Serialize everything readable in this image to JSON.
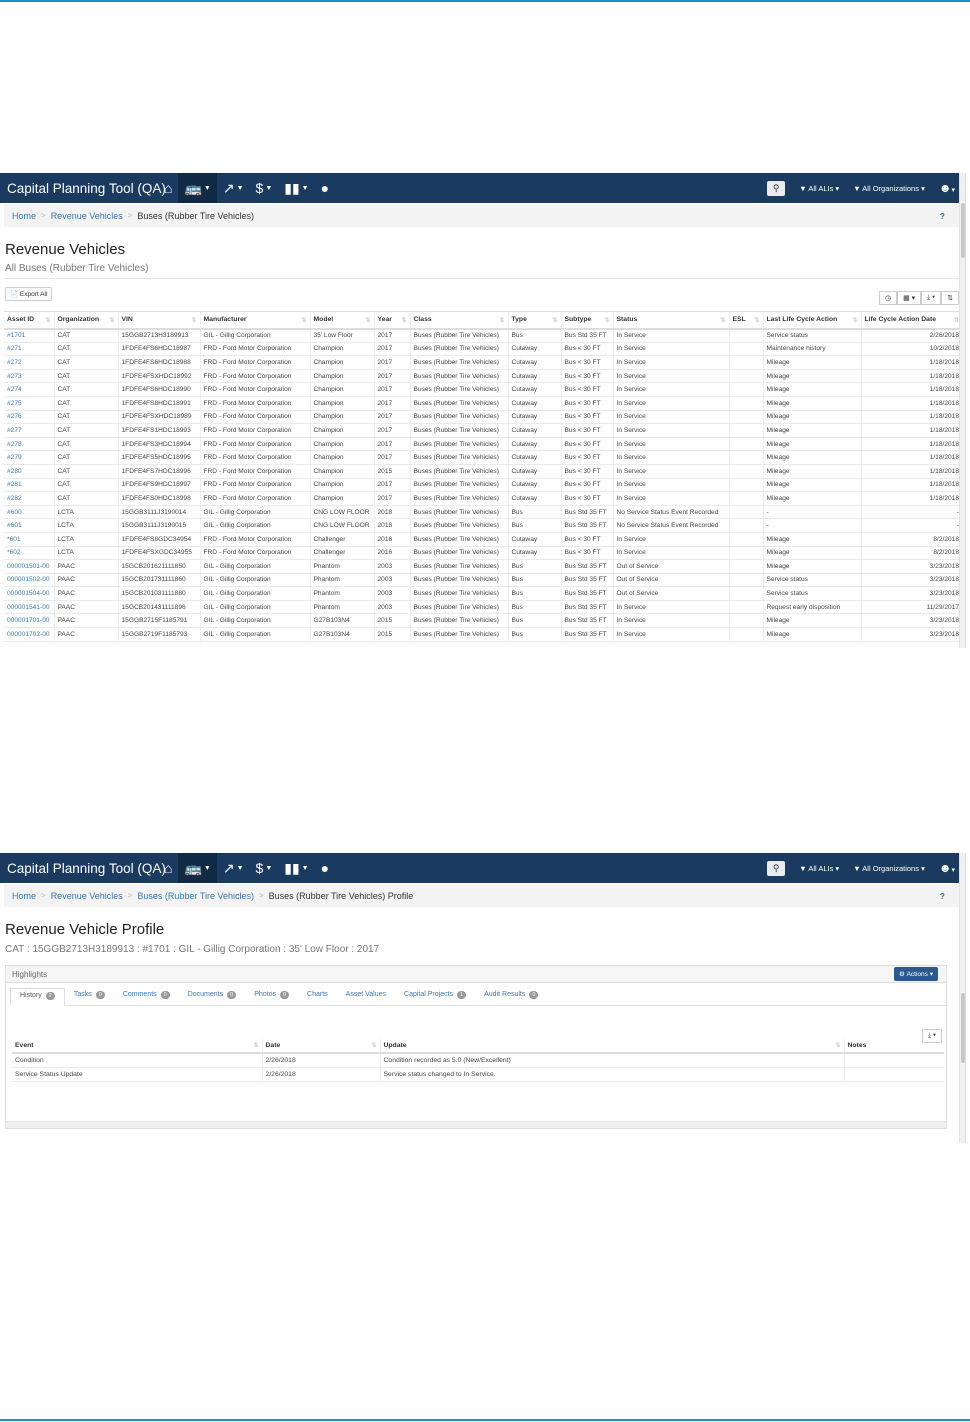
{
  "screen1": {
    "navbar": {
      "brand": "Capital Planning Tool (QA)",
      "icons": [
        "home-icon",
        "bus-icon",
        "chart-line-icon",
        "dollar-icon",
        "bar-chart-icon",
        "globe-icon"
      ],
      "filter_alis": "All ALIs",
      "filter_orgs": "All Organizations"
    },
    "breadcrumb": [
      "Home",
      "Revenue Vehicles",
      "Buses (Rubber Tire Vehicles)"
    ],
    "help": "?",
    "title": "Revenue Vehicles",
    "subtitle": "All Buses (Rubber Tire Vehicles)",
    "export_label": "Export All",
    "columns": [
      "Asset ID",
      "Organization",
      "VIN",
      "Manufacturer",
      "Model",
      "Year",
      "Class",
      "Type",
      "Subtype",
      "Status",
      "ESL",
      "Last Life Cycle Action",
      "Life Cycle Action Date"
    ],
    "rows": [
      [
        "#1701",
        "CAT",
        "15GGB2713H3189913",
        "GIL - Gillig Corporation",
        "35' Low Floor",
        "2017",
        "Buses (Rubber Tire Vehicles)",
        "Bus",
        "Bus Std 35 FT",
        "In Service",
        "",
        "Service status",
        "2/26/2018"
      ],
      [
        "#271",
        "CAT",
        "1FDFE4FS6HDC18987",
        "FRD - Ford Motor Corporation",
        "Champion",
        "2017",
        "Buses (Rubber Tire Vehicles)",
        "Cutaway",
        "Bus < 30 FT",
        "In Service",
        "",
        "Maintenance history",
        "10/2/2018"
      ],
      [
        "#272",
        "CAT",
        "1FDFE4FS6HDC18988",
        "FRD - Ford Motor Corporation",
        "Champion",
        "2017",
        "Buses (Rubber Tire Vehicles)",
        "Cutaway",
        "Bus < 30 FT",
        "In Service",
        "",
        "Mileage",
        "1/18/2018"
      ],
      [
        "#273",
        "CAT",
        "1FDFE4FSXHDC18992",
        "FRD - Ford Motor Corporation",
        "Champion",
        "2017",
        "Buses (Rubber Tire Vehicles)",
        "Cutaway",
        "Bus < 30 FT",
        "In Service",
        "",
        "Mileage",
        "1/18/2018"
      ],
      [
        "#274",
        "CAT",
        "1FDFE4FS6HDC18990",
        "FRD - Ford Motor Corporation",
        "Champion",
        "2017",
        "Buses (Rubber Tire Vehicles)",
        "Cutaway",
        "Bus < 30 FT",
        "In Service",
        "",
        "Mileage",
        "1/18/2018"
      ],
      [
        "#275",
        "CAT",
        "1FDFE4FS8HDC18991",
        "FRD - Ford Motor Corporation",
        "Champion",
        "2017",
        "Buses (Rubber Tire Vehicles)",
        "Cutaway",
        "Bus < 30 FT",
        "In Service",
        "",
        "Mileage",
        "1/18/2018"
      ],
      [
        "#276",
        "CAT",
        "1FDFE4FSXHDC18989",
        "FRD - Ford Motor Corporation",
        "Champion",
        "2017",
        "Buses (Rubber Tire Vehicles)",
        "Cutaway",
        "Bus < 30 FT",
        "In Service",
        "",
        "Mileage",
        "1/18/2018"
      ],
      [
        "#277",
        "CAT",
        "1FDFE4FS1HDC18993",
        "FRD - Ford Motor Corporation",
        "Champion",
        "2017",
        "Buses (Rubber Tire Vehicles)",
        "Cutaway",
        "Bus < 30 FT",
        "In Service",
        "",
        "Mileage",
        "1/18/2018"
      ],
      [
        "#278",
        "CAT",
        "1FDFE4FS3HDC18994",
        "FRD - Ford Motor Corporation",
        "Champion",
        "2017",
        "Buses (Rubber Tire Vehicles)",
        "Cutaway",
        "Bus < 30 FT",
        "In Service",
        "",
        "Mileage",
        "1/18/2018"
      ],
      [
        "#279",
        "CAT",
        "1FDFE4FS5HDC18995",
        "FRD - Ford Motor Corporation",
        "Champion",
        "2017",
        "Buses (Rubber Tire Vehicles)",
        "Cutaway",
        "Bus < 30 FT",
        "In Service",
        "",
        "Mileage",
        "1/18/2018"
      ],
      [
        "#280",
        "CAT",
        "1FDFE4FS7HDC18996",
        "FRD - Ford Motor Corporation",
        "Champion",
        "2015",
        "Buses (Rubber Tire Vehicles)",
        "Cutaway",
        "Bus < 30 FT",
        "In Service",
        "",
        "Mileage",
        "1/18/2018"
      ],
      [
        "#281",
        "CAT",
        "1FDFE4FS9HDC18997",
        "FRD - Ford Motor Corporation",
        "Champion",
        "2017",
        "Buses (Rubber Tire Vehicles)",
        "Cutaway",
        "Bus < 30 FT",
        "In Service",
        "",
        "Mileage",
        "1/18/2018"
      ],
      [
        "#282",
        "CAT",
        "1FDFE4FS0HDC18998",
        "FRD - Ford Motor Corporation",
        "Champion",
        "2017",
        "Buses (Rubber Tire Vehicles)",
        "Cutaway",
        "Bus < 30 FT",
        "In Service",
        "",
        "Mileage",
        "1/18/2018"
      ],
      [
        "#600",
        "LCTA",
        "15GGB3111J3190014",
        "GIL - Gillig Corporation",
        "CNG LOW FLOOR",
        "2018",
        "Buses (Rubber Tire Vehicles)",
        "Bus",
        "Bus Std 35 FT",
        "No Service Status Event Recorded",
        "",
        "-",
        "-"
      ],
      [
        "#601",
        "LCTA",
        "15GGB3111J3190015",
        "GIL - Gillig Corporation",
        "CNG LOW FLOOR",
        "2018",
        "Buses (Rubber Tire Vehicles)",
        "Bus",
        "Bus Std 35 FT",
        "No Service Status Event Recorded",
        "",
        "-",
        "-"
      ],
      [
        "*601",
        "LCTA",
        "1FDFE4FS8GDC34954",
        "FRD - Ford Motor Corporation",
        "Challenger",
        "2016",
        "Buses (Rubber Tire Vehicles)",
        "Cutaway",
        "Bus < 30 FT",
        "In Service",
        "",
        "Mileage",
        "8/2/2018"
      ],
      [
        "*602",
        "LCTA",
        "1FDFE4FSXGDC34955",
        "FRD - Ford Motor Corporation",
        "Challenger",
        "2016",
        "Buses (Rubber Tire Vehicles)",
        "Cutaway",
        "Bus < 30 FT",
        "In Service",
        "",
        "Mileage",
        "8/2/2018"
      ],
      [
        "000001501-00",
        "PAAC",
        "15GCB201621111850",
        "GIL - Gillig Corporation",
        "Phantom",
        "2003",
        "Buses (Rubber Tire Vehicles)",
        "Bus",
        "Bus Std 35 FT",
        "Out of Service",
        "",
        "Mileage",
        "3/23/2018"
      ],
      [
        "000001502-00",
        "PAAC",
        "15GCB201731111860",
        "GIL - Gillig Corporation",
        "Phantom",
        "2003",
        "Buses (Rubber Tire Vehicles)",
        "Bus",
        "Bus Std 35 FT",
        "Out of Service",
        "",
        "Service status",
        "3/23/2018"
      ],
      [
        "000001504-00",
        "PAAC",
        "15GCB201031111880",
        "GIL - Gillig Corporation",
        "Phantom",
        "2003",
        "Buses (Rubber Tire Vehicles)",
        "Bus",
        "Bus Std 35 FT",
        "Out of Service",
        "",
        "Service status",
        "3/23/2018"
      ],
      [
        "000001541-00",
        "PAAC",
        "15GCB201431111896",
        "GIL - Gillig Corporation",
        "Phantom",
        "2003",
        "Buses (Rubber Tire Vehicles)",
        "Bus",
        "Bus Std 35 FT",
        "In Service",
        "",
        "Request early disposition",
        "11/29/2017"
      ],
      [
        "000001701-00",
        "PAAC",
        "15GGB2715F1185791",
        "GIL - Gillig Corporation",
        "G27B103N4",
        "2015",
        "Buses (Rubber Tire Vehicles)",
        "Bus",
        "Bus Std 35 FT",
        "In Service",
        "",
        "Mileage",
        "3/23/2018"
      ],
      [
        "000001702-00",
        "PAAC",
        "15GGB2719F1185793",
        "GIL - Gillig Corporation",
        "G27B103N4",
        "2015",
        "Buses (Rubber Tire Vehicles)",
        "Bus",
        "Bus Std 35 FT",
        "In Service",
        "",
        "Mileage",
        "3/23/2018"
      ]
    ]
  },
  "screen2": {
    "navbar": {
      "brand": "Capital Planning Tool (QA)",
      "filter_alis": "All ALIs",
      "filter_orgs": "All Organizations"
    },
    "breadcrumb": [
      "Home",
      "Revenue Vehicles",
      "Buses (Rubber Tire Vehicles)",
      "Buses (Rubber Tire Vehicles) Profile"
    ],
    "help": "?",
    "title": "Revenue Vehicle Profile",
    "subtitle": "CAT : 15GGB2713H3189913 : #1701 : GIL - Gillig Corporation : 35' Low Floor : 2017",
    "panel_title": "Highlights",
    "actions_label": "Actions",
    "tabs": [
      {
        "label": "History",
        "badge": "2"
      },
      {
        "label": "Tasks",
        "badge": "0"
      },
      {
        "label": "Comments",
        "badge": "0"
      },
      {
        "label": "Documents",
        "badge": "0"
      },
      {
        "label": "Photos",
        "badge": "0"
      },
      {
        "label": "Charts",
        "badge": ""
      },
      {
        "label": "Asset Values",
        "badge": ""
      },
      {
        "label": "Capital Projects",
        "badge": "1"
      },
      {
        "label": "Audit Results",
        "badge": "0"
      }
    ],
    "columns": [
      "Event",
      "Date",
      "Update",
      "Notes"
    ],
    "rows": [
      [
        "Condition",
        "2/26/2018",
        "Condition recorded as 5.0 (New/Excellent)",
        ""
      ],
      [
        "Service Status Update",
        "2/26/2018",
        "Service status changed to In Service.",
        ""
      ]
    ]
  }
}
